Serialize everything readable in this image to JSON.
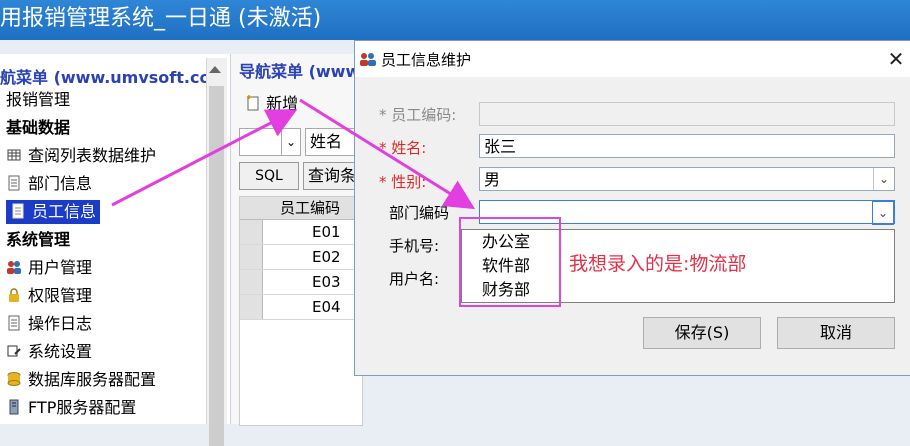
{
  "window": {
    "title": "用报销管理系统_一日通 (未激活)"
  },
  "sidebar": {
    "header": "航菜单 (www.umvsoft.com",
    "items": [
      {
        "label": "报销管理",
        "icon": "none",
        "bold": false
      },
      {
        "label": "基础数据",
        "icon": "none",
        "bold": true
      },
      {
        "label": "查阅列表数据维护",
        "icon": "grid-icon",
        "bold": false
      },
      {
        "label": "部门信息",
        "icon": "document-icon",
        "bold": false
      },
      {
        "label": "员工信息",
        "icon": "document-icon",
        "bold": false,
        "selected": true
      },
      {
        "label": "系统管理",
        "icon": "none",
        "bold": true
      },
      {
        "label": "用户管理",
        "icon": "users-icon",
        "bold": false
      },
      {
        "label": "权限管理",
        "icon": "lock-icon",
        "bold": false
      },
      {
        "label": "操作日志",
        "icon": "document-icon",
        "bold": false
      },
      {
        "label": "系统设置",
        "icon": "settings-icon",
        "bold": false
      },
      {
        "label": "数据库服务器配置",
        "icon": "database-icon",
        "bold": false
      },
      {
        "label": "FTP服务器配置",
        "icon": "server-icon",
        "bold": false
      }
    ]
  },
  "nav_panel": {
    "header": "导航菜单 (www",
    "new_button": "新增",
    "name_label": "姓名",
    "sql_button": "SQL",
    "query_button": "查询条",
    "grid": {
      "column": "员工编码",
      "rows": [
        "E01",
        "E02",
        "E03",
        "E04"
      ]
    }
  },
  "dialog": {
    "title": "员工信息维护",
    "fields": {
      "employee_code": {
        "label": "* 员工编码:",
        "value": ""
      },
      "name": {
        "label": "* 姓名:",
        "value": "张三"
      },
      "gender": {
        "label": "* 性别:",
        "value": "男"
      },
      "department": {
        "label": "部门编码",
        "value": ""
      },
      "phone": {
        "label": "手机号:"
      },
      "username": {
        "label": "用户名:"
      }
    },
    "department_options": [
      "办公室",
      "软件部",
      "财务部"
    ],
    "save_button": "保存(S)",
    "cancel_button": "取消"
  },
  "annotation": {
    "text": "我想录入的是:物流部",
    "color": "#e5304a"
  },
  "colors": {
    "title_bar": "#1f6fc2",
    "selected_item": "#1a3cc7",
    "highlight": "#d64bd8",
    "required_asterisk": "#e02a2a"
  }
}
